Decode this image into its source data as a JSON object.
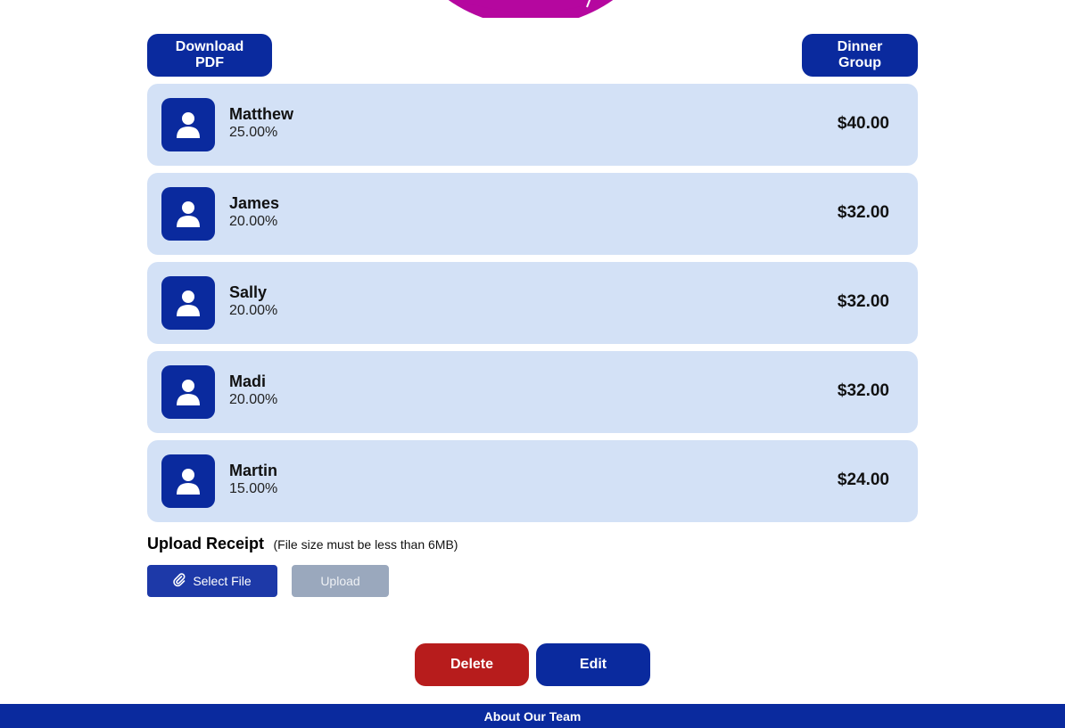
{
  "colors": {
    "primary": "#0a2a9e",
    "row_background": "#d3e1f6",
    "danger": "#b71c1c",
    "disabled": "#9aa8bd",
    "pie_accent": "#b5079f"
  },
  "header": {
    "download_label": "Download PDF",
    "group_label": "Dinner Group"
  },
  "members": [
    {
      "name": "Matthew",
      "percent": "25.00%",
      "amount": "$40.00",
      "icon": "user-icon"
    },
    {
      "name": "James",
      "percent": "20.00%",
      "amount": "$32.00",
      "icon": "user-icon"
    },
    {
      "name": "Sally",
      "percent": "20.00%",
      "amount": "$32.00",
      "icon": "user-icon"
    },
    {
      "name": "Madi",
      "percent": "20.00%",
      "amount": "$32.00",
      "icon": "user-icon"
    },
    {
      "name": "Martin",
      "percent": "15.00%",
      "amount": "$24.00",
      "icon": "user-icon"
    }
  ],
  "upload": {
    "title": "Upload Receipt",
    "note": "(File size must be less than 6MB)",
    "select_label": "Select File",
    "select_icon": "paperclip-icon",
    "upload_label": "Upload"
  },
  "actions": {
    "delete_label": "Delete",
    "edit_label": "Edit"
  },
  "footer": {
    "link_label": "About Our Team"
  }
}
